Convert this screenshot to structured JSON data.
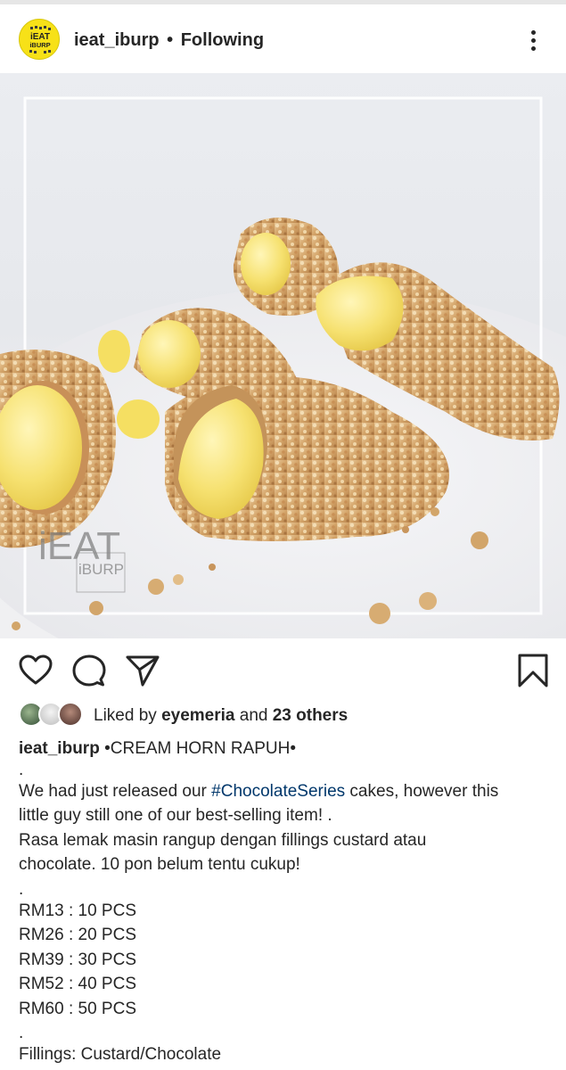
{
  "post": {
    "username": "ieat_iburp",
    "separator": "•",
    "follow_status": "Following",
    "avatar_logo_line1": "iEAT",
    "avatar_logo_line2": "iBURP",
    "watermark_line1": "iEAT",
    "watermark_line2": "iBURP",
    "likes": {
      "prefix": "Liked by",
      "first_user": "eyemeria",
      "conjunction": "and",
      "others": "23 others"
    },
    "caption": {
      "username": "ieat_iburp",
      "title": "•CREAM HORN RAPUH•",
      "dot1": ".",
      "line1_a": "We had just released our ",
      "hashtag": "#ChocolateSeries",
      "line1_b": " cakes, however this",
      "line2": "little guy still one of our best-selling item! .",
      "line3": "Rasa lemak masin rangup dengan fillings custard atau",
      "line4": "chocolate. 10 pon belum tentu cukup!",
      "dot2": ".",
      "prices": [
        "RM13 : 10 PCS",
        "RM26 : 20 PCS",
        "RM39 : 30 PCS",
        "RM52 : 40 PCS",
        "RM60 : 50 PCS"
      ],
      "dot3": ".",
      "fillings": "Fillings: Custard/Chocolate"
    }
  },
  "icons": {
    "more": "more-vertical-icon",
    "like": "heart-icon",
    "comment": "comment-icon",
    "share": "send-icon",
    "save": "bookmark-icon"
  },
  "colors": {
    "avatar_bg": "#f7e118",
    "hashtag": "#00376b",
    "text": "#262626"
  }
}
